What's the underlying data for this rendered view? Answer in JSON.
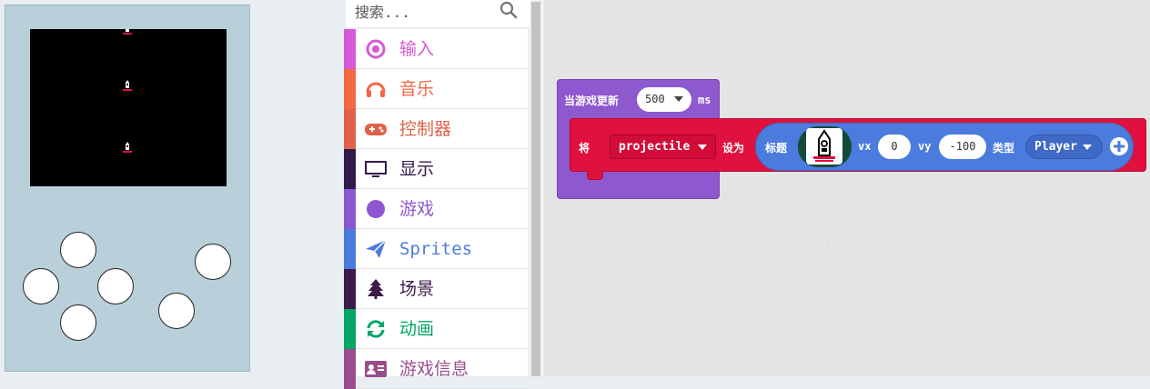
{
  "search": {
    "placeholder": "搜索..."
  },
  "toolbox": {
    "categories": [
      {
        "label": "输入",
        "color": "#d659d6",
        "icon": "circle-target-icon"
      },
      {
        "label": "音乐",
        "color": "#f26845",
        "icon": "headphones-icon"
      },
      {
        "label": "控制器",
        "color": "#e0614a",
        "icon": "gamepad-icon"
      },
      {
        "label": "显示",
        "color": "#2f1b4b",
        "icon": "monitor-icon"
      },
      {
        "label": "游戏",
        "color": "#8d57d2",
        "icon": "circle-icon"
      },
      {
        "label": "Sprites",
        "color": "#4b7bdc",
        "icon": "paper-plane-icon"
      },
      {
        "label": "场景",
        "color": "#3c1a4a",
        "icon": "tree-icon"
      },
      {
        "label": "动画",
        "color": "#04a565",
        "icon": "refresh-icon"
      },
      {
        "label": "游戏信息",
        "color": "#9a4d8e",
        "icon": "id-card-icon"
      }
    ]
  },
  "workspace": {
    "event_block": {
      "title": "当游戏更新",
      "interval": "500",
      "unit": "ms",
      "color": "#8e58cf"
    },
    "set_block": {
      "label": "将",
      "variable": "projectile",
      "set_to": "设为",
      "color": "#e0103f",
      "create": {
        "image_label": "标题",
        "vx_label": "vx",
        "vx": "0",
        "vy_label": "vy",
        "vy": "-100",
        "kind_label": "类型",
        "kind": "Player",
        "color": "#4b7bdc"
      }
    }
  },
  "simulator": {
    "screen_color": "#000000",
    "sprite_icon": "rocket-sprite-icon",
    "buttons": [
      "dpad-up-button",
      "dpad-left-button",
      "dpad-right-button",
      "dpad-down-button",
      "a-button",
      "b-button"
    ]
  }
}
